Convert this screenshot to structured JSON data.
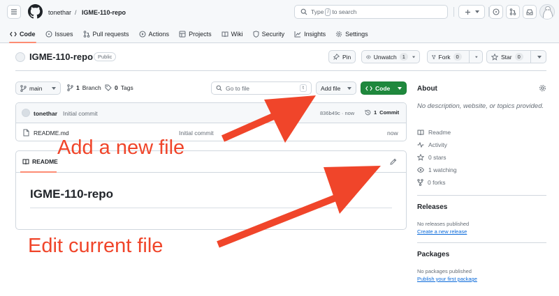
{
  "header": {
    "owner": "tonethar",
    "separator": "/",
    "repo": "IGME-110-repo",
    "search_prefix": "Type",
    "search_key": "/",
    "search_suffix": "to search"
  },
  "tabs": [
    {
      "label": "Code",
      "icon": "code-icon"
    },
    {
      "label": "Issues",
      "icon": "issue-icon"
    },
    {
      "label": "Pull requests",
      "icon": "pull-request-icon"
    },
    {
      "label": "Actions",
      "icon": "play-icon"
    },
    {
      "label": "Projects",
      "icon": "table-icon"
    },
    {
      "label": "Wiki",
      "icon": "book-icon"
    },
    {
      "label": "Security",
      "icon": "shield-icon"
    },
    {
      "label": "Insights",
      "icon": "graph-icon"
    },
    {
      "label": "Settings",
      "icon": "gear-icon"
    }
  ],
  "repo_header": {
    "name": "IGME-110-repo",
    "visibility": "Public",
    "pin_label": "Pin",
    "unwatch_label": "Unwatch",
    "unwatch_count": "1",
    "fork_label": "Fork",
    "fork_count": "0",
    "star_label": "Star",
    "star_count": "0"
  },
  "file_nav": {
    "branch": "main",
    "branch_count": "1",
    "branch_label": "Branch",
    "tag_count": "0",
    "tag_label": "Tags",
    "goto_placeholder": "Go to file",
    "goto_key": "t",
    "add_file_label": "Add file",
    "code_label": "Code"
  },
  "latest_commit": {
    "author": "tonethar",
    "message": "Initial commit",
    "hash_time": "836b49c · now",
    "commits_count": "1",
    "commits_label": "Commit"
  },
  "files": [
    {
      "name": "README.md",
      "commit": "Initial commit",
      "time": "now"
    }
  ],
  "readme": {
    "tab_label": "README",
    "heading": "IGME-110-repo"
  },
  "sidebar": {
    "about_title": "About",
    "about_text": "No description, website, or topics provided.",
    "items": [
      {
        "label": "Readme",
        "icon": "book-icon"
      },
      {
        "label": "Activity",
        "icon": "pulse-icon"
      },
      {
        "label": "0 stars",
        "icon": "star-icon"
      },
      {
        "label": "1 watching",
        "icon": "eye-icon"
      },
      {
        "label": "0 forks",
        "icon": "fork-icon"
      }
    ],
    "releases_title": "Releases",
    "releases_text": "No releases published",
    "releases_link": "Create a new release",
    "packages_title": "Packages",
    "packages_text": "No packages published",
    "packages_link": "Publish your first package"
  },
  "annotations": {
    "add_file": "Add a new file",
    "edit_file": "Edit current file",
    "color": "#f0452a"
  },
  "colors": {
    "accent_green": "#1f883d",
    "tab_underline": "#fd8c73",
    "link": "#0969da"
  }
}
